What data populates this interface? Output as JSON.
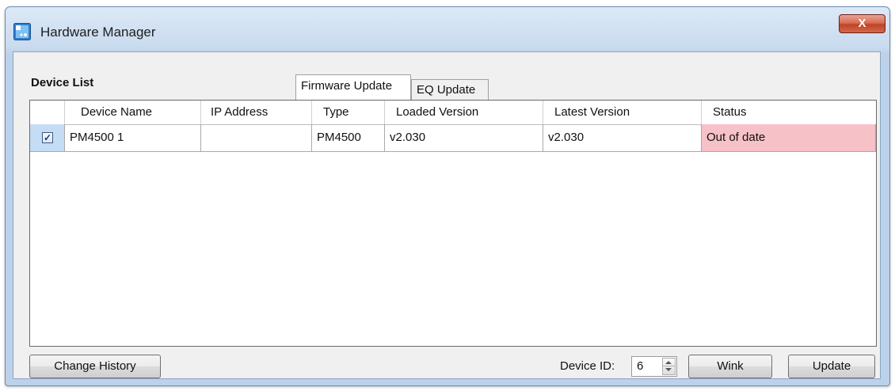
{
  "window": {
    "title": "Hardware Manager",
    "close_label": "X"
  },
  "device_list": {
    "label": "Device List"
  },
  "tabs": [
    {
      "label": "Firmware Update",
      "active": true
    },
    {
      "label": "EQ Update",
      "active": false
    }
  ],
  "table": {
    "columns": [
      "Device Name",
      "IP Address",
      "Type",
      "Loaded Version",
      "Latest Version",
      "Status"
    ],
    "rows": [
      {
        "checked": true,
        "check_glyph": "✓",
        "device_name": "PM4500 1",
        "ip_address": "",
        "type": "PM4500",
        "loaded_version": "v2.030",
        "latest_version": "v2.030",
        "status": "Out of date"
      }
    ]
  },
  "footer": {
    "change_history_label": "Change History",
    "device_id_label": "Device ID:",
    "device_id_value": "6",
    "wink_label": "Wink",
    "update_label": "Update"
  },
  "colors": {
    "status_out_of_date_bg": "#f6c1c7",
    "row_header_selected": "#c5dcf5"
  }
}
